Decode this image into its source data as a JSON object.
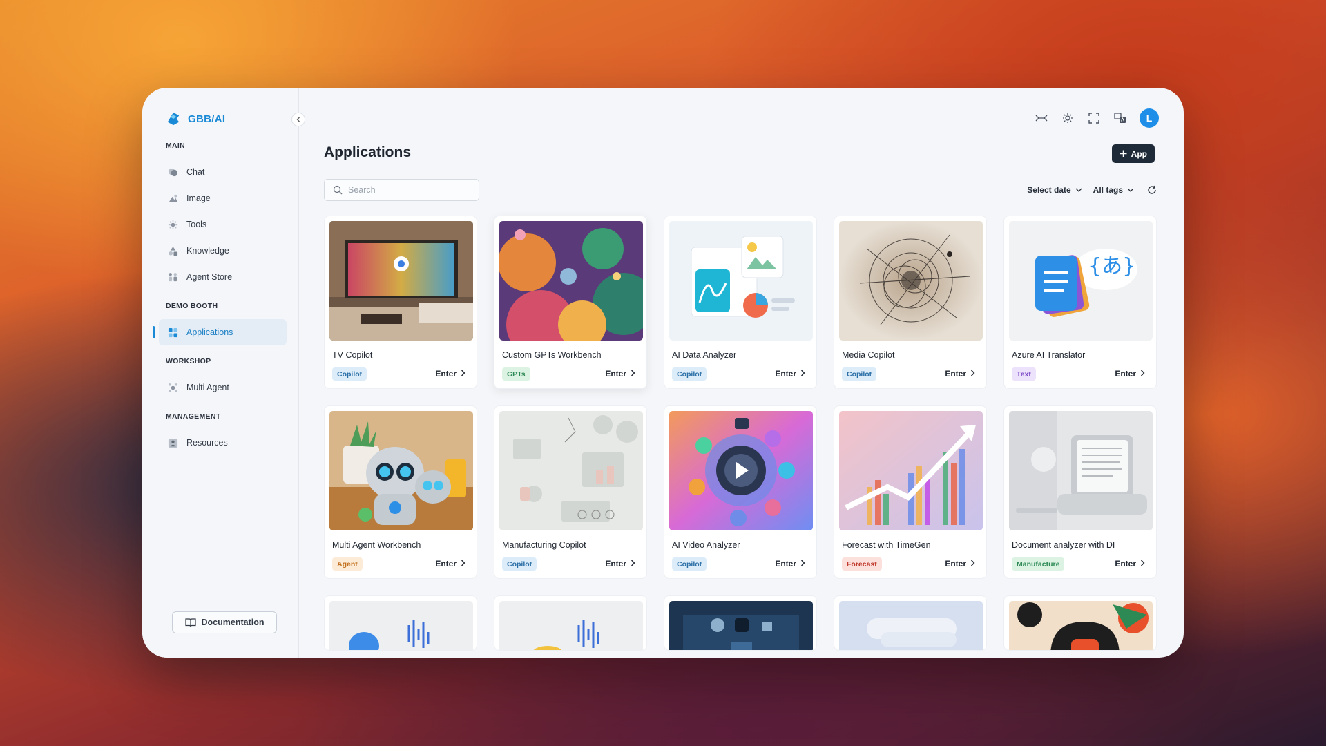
{
  "brand": {
    "name": "GBB/AI"
  },
  "sidebar": {
    "sections": [
      {
        "label": "MAIN",
        "items": [
          {
            "label": "Chat",
            "icon": "chat-icon"
          },
          {
            "label": "Image",
            "icon": "image-icon"
          },
          {
            "label": "Tools",
            "icon": "tools-icon"
          },
          {
            "label": "Knowledge",
            "icon": "knowledge-icon"
          },
          {
            "label": "Agent Store",
            "icon": "agent-store-icon"
          }
        ]
      },
      {
        "label": "DEMO BOOTH",
        "items": [
          {
            "label": "Applications",
            "icon": "applications-icon",
            "active": true
          }
        ]
      },
      {
        "label": "WORKSHOP",
        "items": [
          {
            "label": "Multi Agent",
            "icon": "multi-agent-icon"
          }
        ]
      },
      {
        "label": "MANAGEMENT",
        "items": [
          {
            "label": "Resources",
            "icon": "resources-icon"
          }
        ]
      }
    ],
    "documentation_label": "Documentation"
  },
  "header": {
    "avatar_initial": "L",
    "page_title": "Applications",
    "add_button_label": "App"
  },
  "search": {
    "placeholder": "Search"
  },
  "filters": {
    "date_label": "Select date",
    "tags_label": "All tags"
  },
  "tag_colors": {
    "Copilot": {
      "bg": "#dcecf9",
      "fg": "#2a6ea6"
    },
    "GPTs": {
      "bg": "#dcf3e4",
      "fg": "#2e8a55"
    },
    "Text": {
      "bg": "#ece2fb",
      "fg": "#7a45c7"
    },
    "Agent": {
      "bg": "#fcebd6",
      "fg": "#c2701e"
    },
    "Forecast": {
      "bg": "#fbe0dc",
      "fg": "#c0392b"
    },
    "Manufacture": {
      "bg": "#dcf3e4",
      "fg": "#2e8a55"
    }
  },
  "cards": [
    {
      "title": "TV Copilot",
      "tag": "Copilot",
      "enter": "Enter"
    },
    {
      "title": "Custom GPTs Workbench",
      "tag": "GPTs",
      "enter": "Enter"
    },
    {
      "title": "AI Data Analyzer",
      "tag": "Copilot",
      "enter": "Enter"
    },
    {
      "title": "Media Copilot",
      "tag": "Copilot",
      "enter": "Enter"
    },
    {
      "title": "Azure AI Translator",
      "tag": "Text",
      "enter": "Enter"
    },
    {
      "title": "Multi Agent Workbench",
      "tag": "Agent",
      "enter": "Enter"
    },
    {
      "title": "Manufacturing Copilot",
      "tag": "Copilot",
      "enter": "Enter"
    },
    {
      "title": "AI Video Analyzer",
      "tag": "Copilot",
      "enter": "Enter"
    },
    {
      "title": "Forecast with TimeGen",
      "tag": "Forecast",
      "enter": "Enter"
    },
    {
      "title": "Document analyzer with DI",
      "tag": "Manufacture",
      "enter": "Enter"
    }
  ]
}
